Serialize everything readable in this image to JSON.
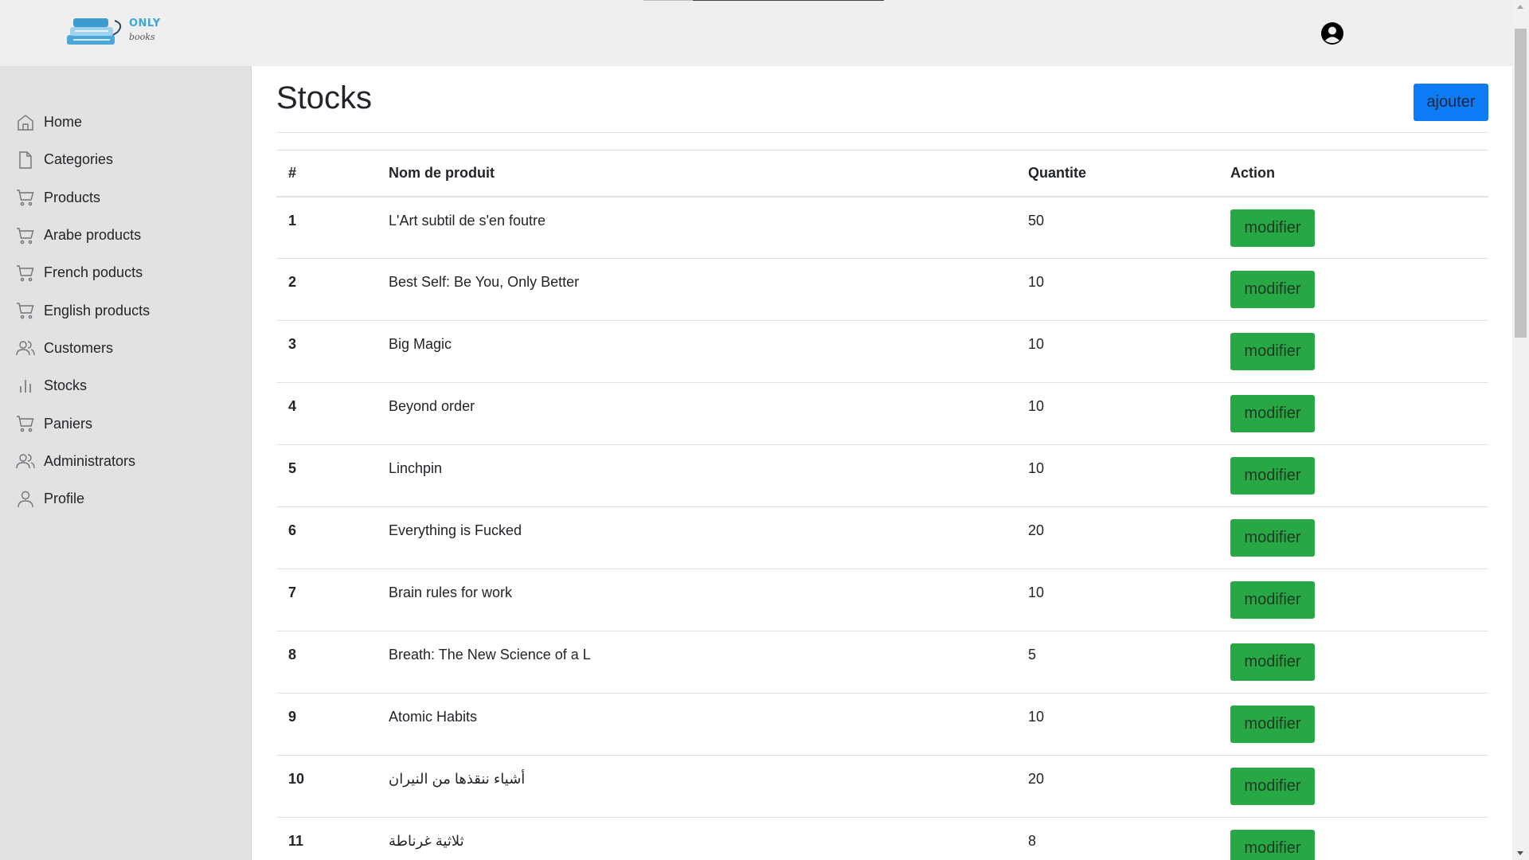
{
  "header": {
    "logo": {
      "text": "ONLY",
      "sub": "books"
    },
    "user_icon": "user-circle-icon"
  },
  "sidebar": {
    "items": [
      {
        "label": "Home",
        "icon": "home-icon"
      },
      {
        "label": "Categories",
        "icon": "file-icon"
      },
      {
        "label": "Products",
        "icon": "cart-icon"
      },
      {
        "label": "Arabe products",
        "icon": "cart-icon"
      },
      {
        "label": "French poducts",
        "icon": "cart-icon"
      },
      {
        "label": "English products",
        "icon": "cart-icon"
      },
      {
        "label": "Customers",
        "icon": "users-icon"
      },
      {
        "label": "Stocks",
        "icon": "bar-chart-icon"
      },
      {
        "label": "Paniers",
        "icon": "cart-icon"
      },
      {
        "label": "Administrators",
        "icon": "users-icon"
      },
      {
        "label": "Profile",
        "icon": "user-icon"
      }
    ]
  },
  "main": {
    "title": "Stocks",
    "add_label": "ajouter",
    "table": {
      "headers": {
        "num": "#",
        "name": "Nom de produit",
        "qty": "Quantite",
        "action": "Action"
      },
      "action_label": "modifier",
      "rows": [
        {
          "num": "1",
          "name": "L'Art subtil de s'en foutre",
          "qty": "50"
        },
        {
          "num": "2",
          "name": "Best Self: Be You, Only Better",
          "qty": "10"
        },
        {
          "num": "3",
          "name": "Big Magic",
          "qty": "10"
        },
        {
          "num": "4",
          "name": "Beyond order",
          "qty": "10"
        },
        {
          "num": "5",
          "name": "Linchpin",
          "qty": "10"
        },
        {
          "num": "6",
          "name": "Everything is Fucked",
          "qty": "20"
        },
        {
          "num": "7",
          "name": "Brain rules for work",
          "qty": "10"
        },
        {
          "num": "8",
          "name": "Breath: The New Science of a L",
          "qty": "5"
        },
        {
          "num": "9",
          "name": "Atomic Habits",
          "qty": "10"
        },
        {
          "num": "10",
          "name": "أشياء ننقذها من النيران",
          "qty": "20"
        },
        {
          "num": "11",
          "name": "ثلاثية غرناطة",
          "qty": "8"
        }
      ]
    }
  },
  "colors": {
    "primary": "#0d7bf5",
    "success": "#28a745",
    "topbar": "#efefef",
    "sidebar": "#e2e2e2"
  }
}
